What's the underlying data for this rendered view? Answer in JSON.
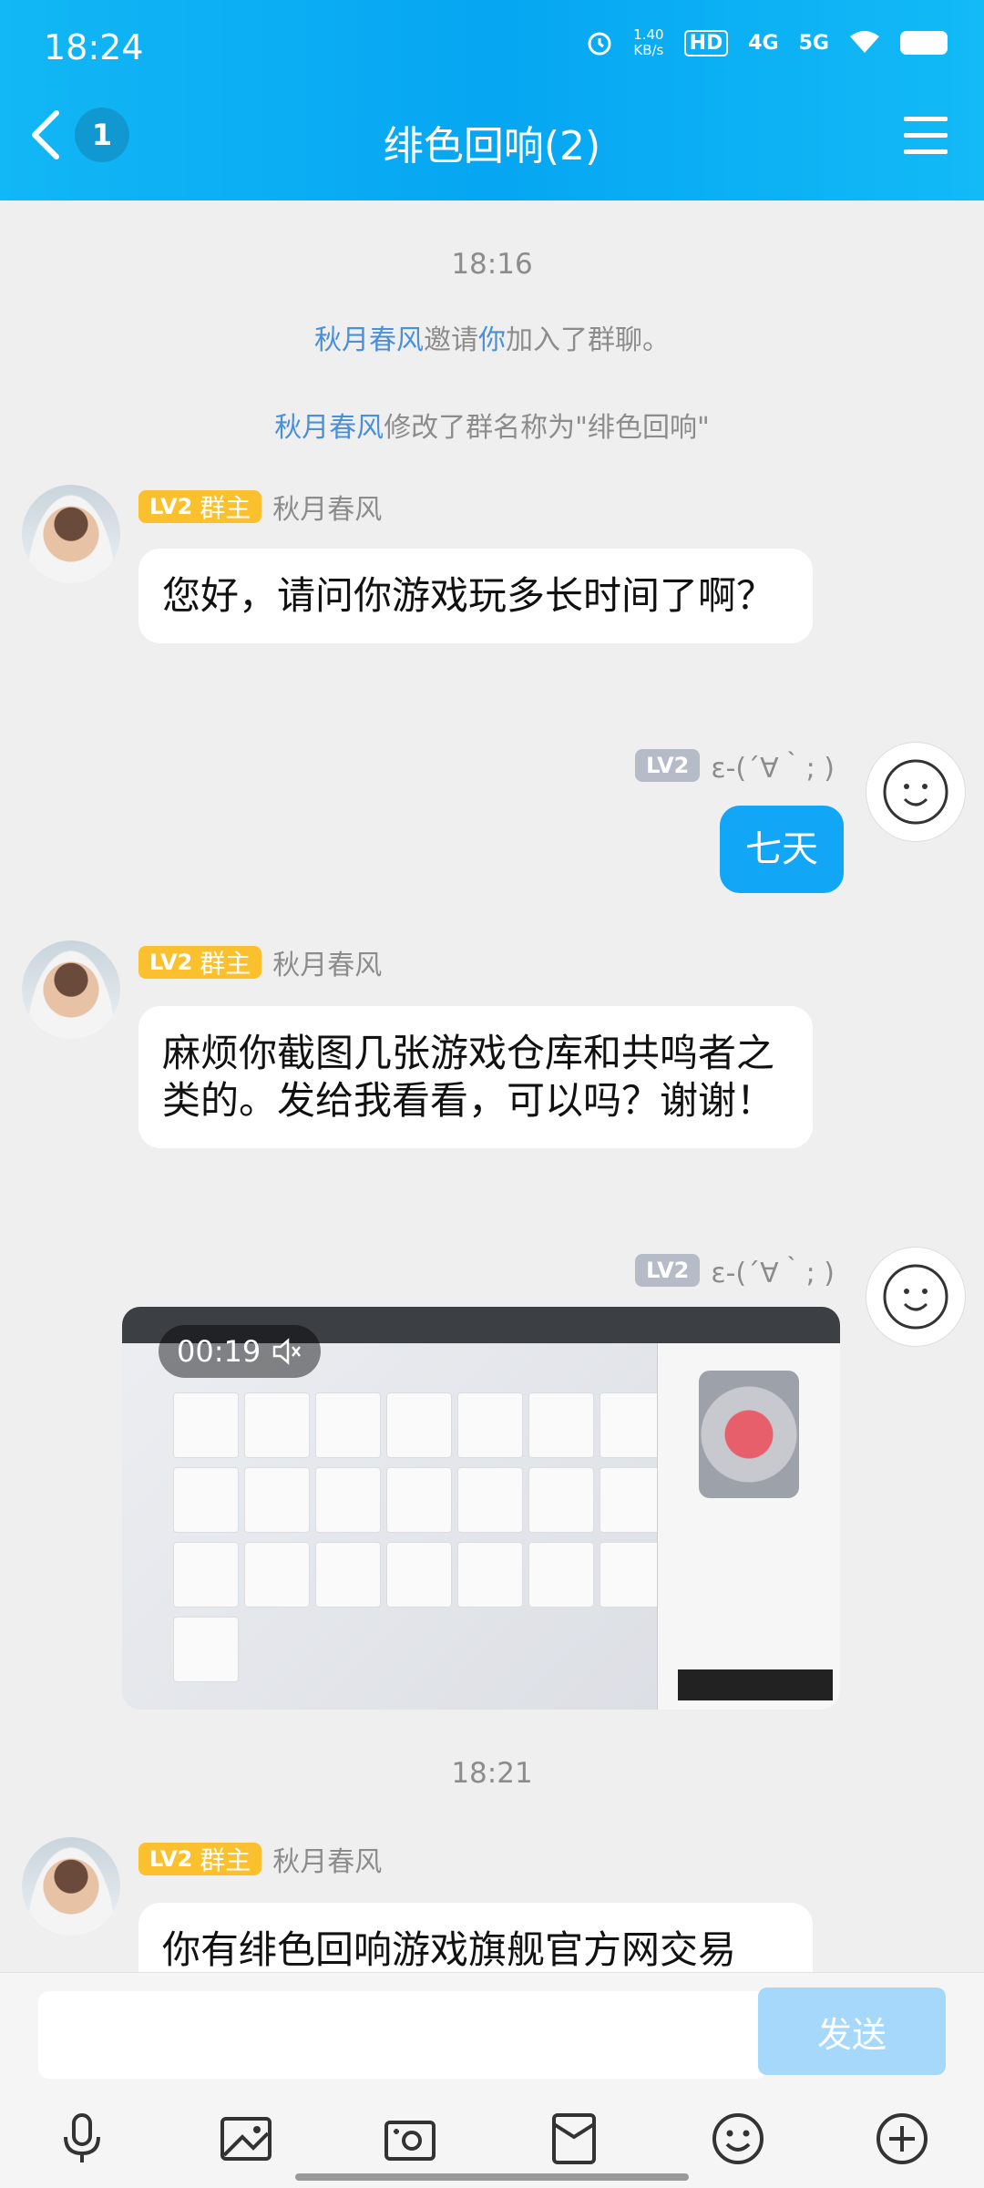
{
  "status_bar": {
    "time": "18:24",
    "net_speed_value": "1.40",
    "net_speed_unit": "KB/s",
    "hd_label": "HD",
    "net1": "4G",
    "net2": "5G"
  },
  "header": {
    "back_count": "1",
    "title": "绯色回响(2)"
  },
  "chat": {
    "time1": "18:16",
    "invite_actor": "秋月春风",
    "invite_mid": "邀请",
    "invite_target": "你",
    "invite_tail": "加入了群聊。",
    "rename_actor": "秋月春风",
    "rename_tail": "修改了群名称为\"绯色回响\"",
    "owner_name": "秋月春风",
    "owner_level": "LV2",
    "owner_role": "群主",
    "me_name": "ε-(´∀｀; )",
    "me_level": "LV2",
    "msg1": "您好，请问你游戏玩多长时间了啊？",
    "msg2": "七天",
    "msg3": "麻烦你截图几张游戏仓库和共鸣者之类的。发给我看看，可以吗？谢谢！",
    "video_duration": "00:19",
    "time2": "18:21",
    "msg4": "你有绯色回响游戏旗舰官方网交易"
  },
  "input": {
    "send_label": "发送"
  },
  "icons": [
    "mic-icon",
    "image-icon",
    "camera-icon",
    "red-packet-icon",
    "emoji-icon",
    "plus-icon"
  ],
  "colors": {
    "header": "#12b7f5",
    "bubble_self": "#12a6f7",
    "owner_badge": "#fbc02d",
    "link": "#4a90d9"
  }
}
